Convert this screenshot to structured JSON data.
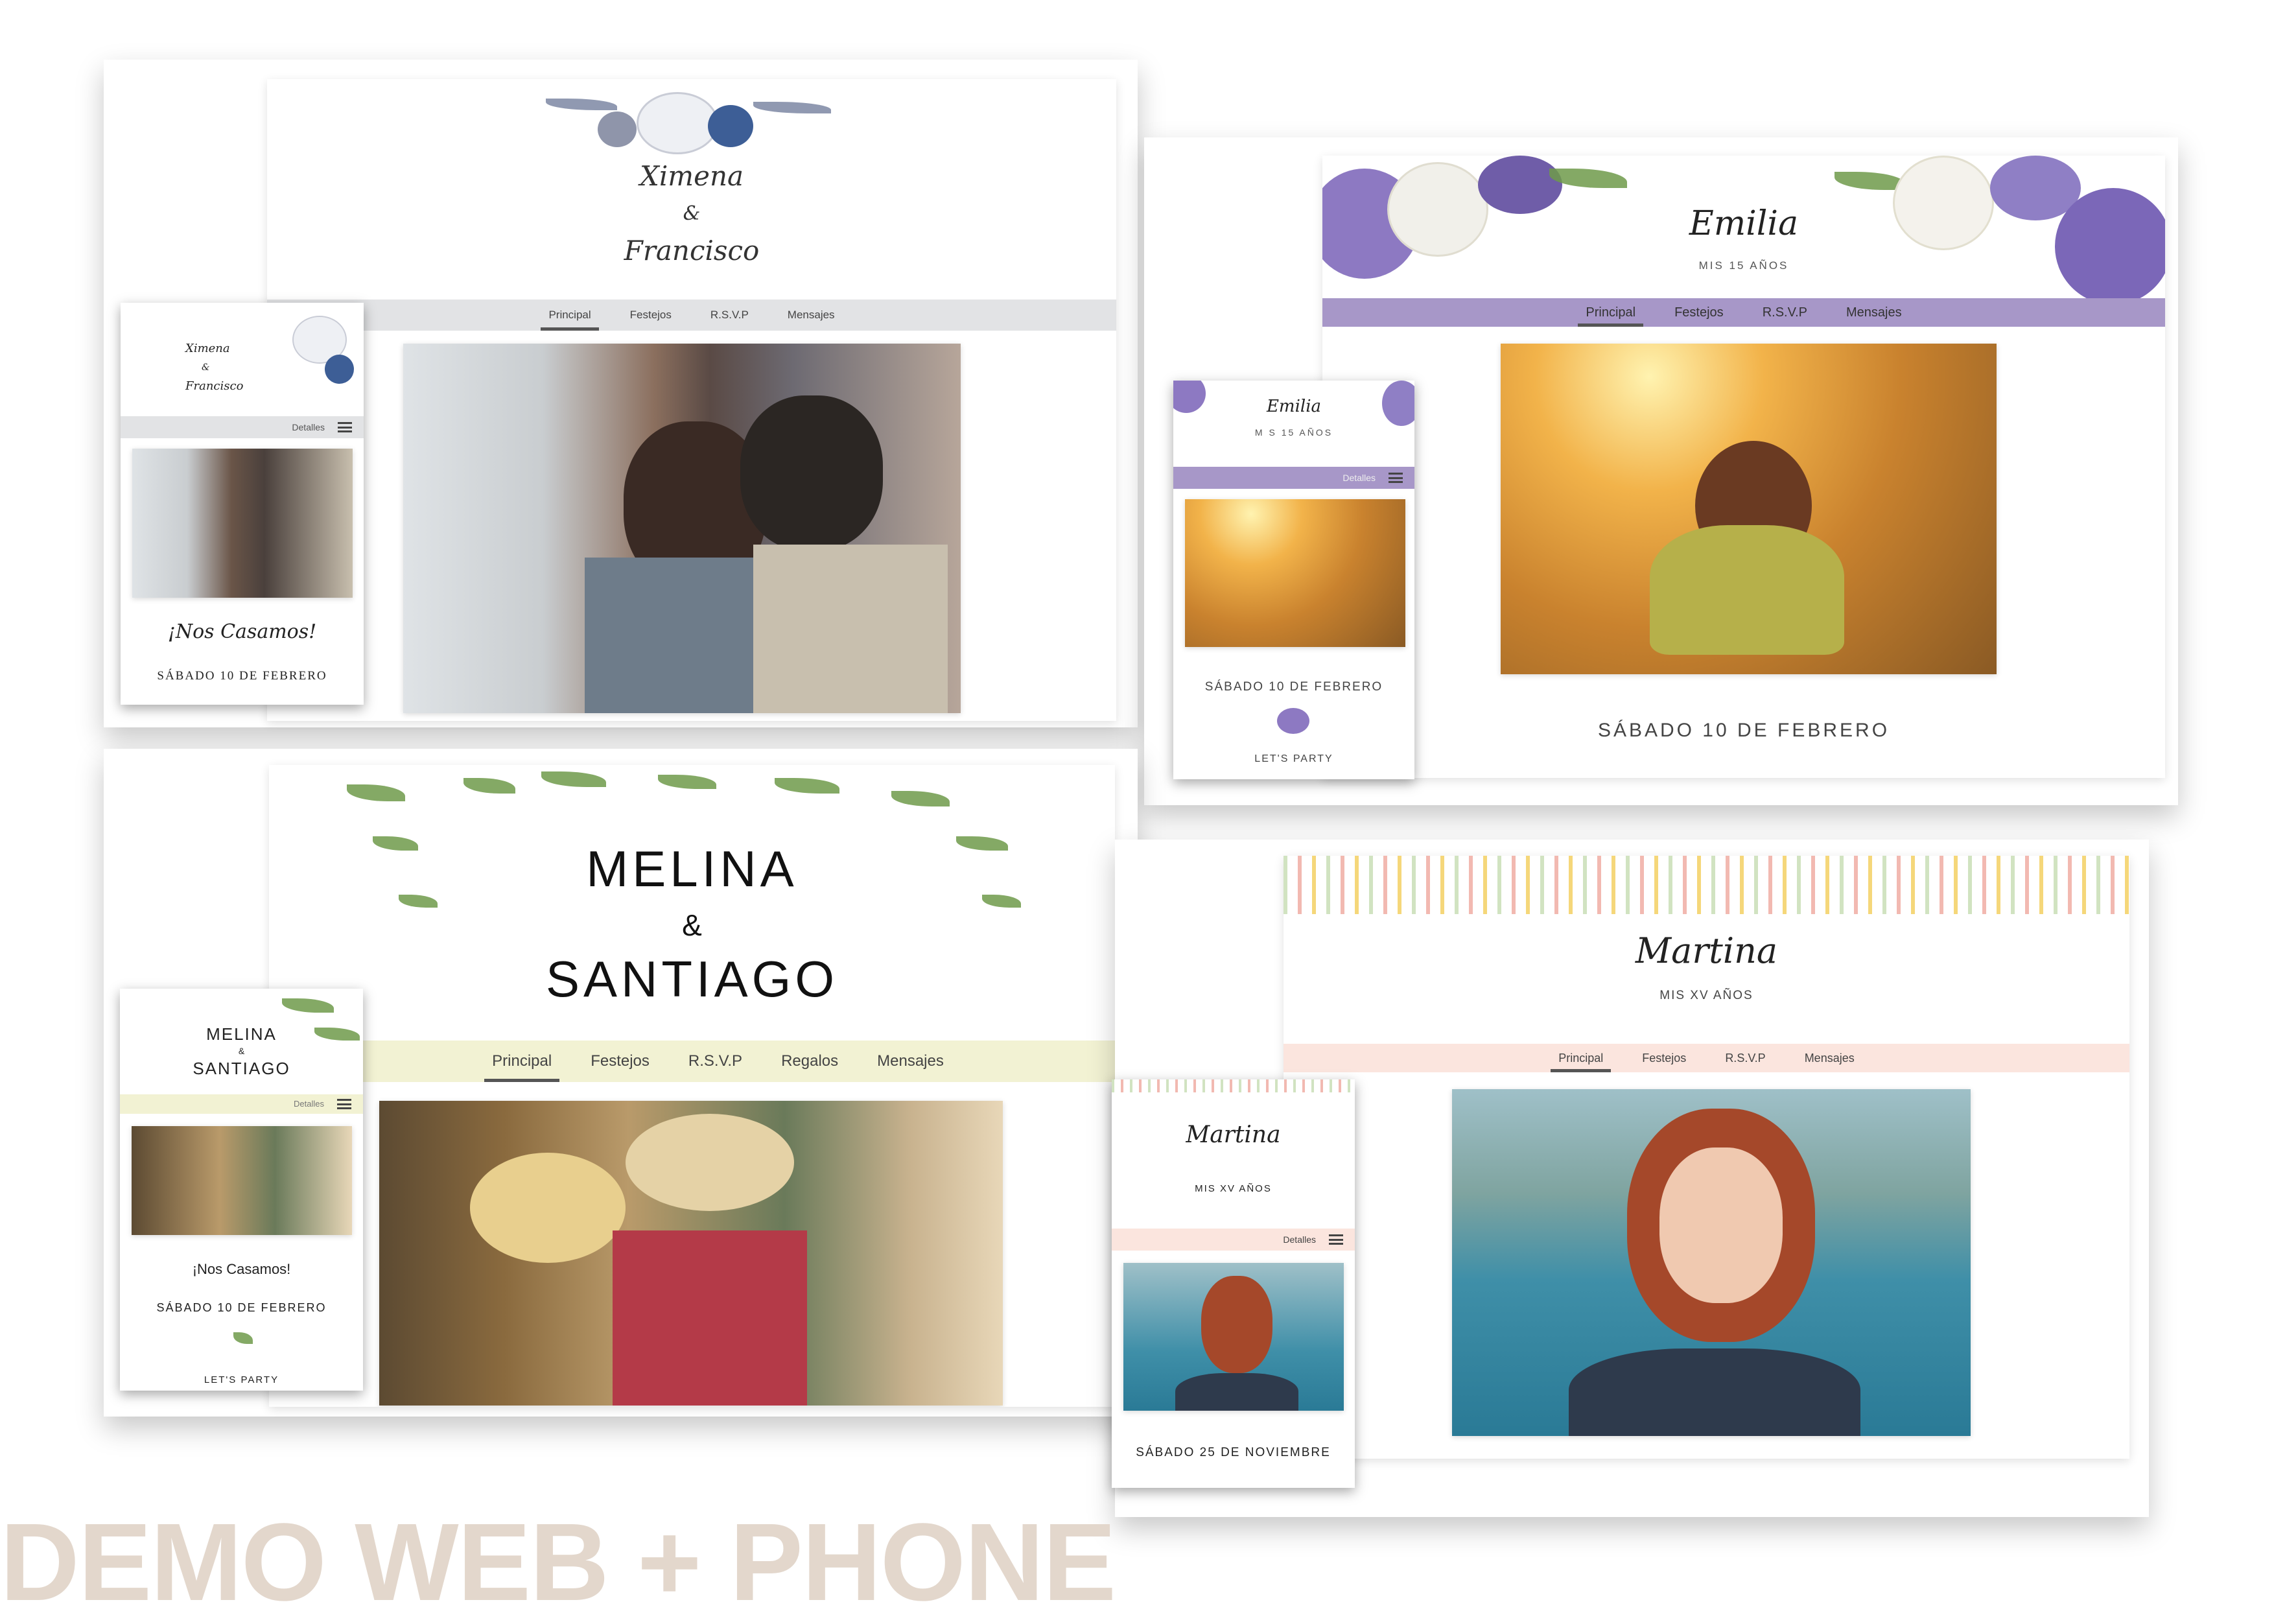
{
  "headline": "DEMO WEB + PHONE",
  "colors": {
    "headline": "#e3d7cc",
    "emilia_bar": "#a797c8",
    "melina_bar": "#f2f2d3",
    "martina_bar": "#fbe5de",
    "ximena_bar": "#e2e3e5"
  },
  "ximena": {
    "desktop": {
      "name1": "Ximena",
      "amp": "&",
      "name2": "Francisco",
      "nav": [
        "Principal",
        "Festejos",
        "R.S.V.P",
        "Mensajes"
      ]
    },
    "phone": {
      "name1": "Ximena",
      "amp": "&",
      "name2": "Francisco",
      "menu": "Detalles",
      "tagline": "¡Nos Casamos!",
      "date": "SÁBADO 10 DE FEBRERO"
    }
  },
  "emilia": {
    "desktop": {
      "name": "Emilia",
      "subtitle": "MIS 15 AÑOS",
      "nav": [
        "Principal",
        "Festejos",
        "R.S.V.P",
        "Mensajes"
      ],
      "date": "SÁBADO 10 DE FEBRERO"
    },
    "phone": {
      "name": "Emilia",
      "subtitle": "M S 15 AÑOS",
      "menu": "Detalles",
      "date": "SÁBADO 10 DE FEBRERO",
      "cta": "LET'S PARTY"
    }
  },
  "melina": {
    "desktop": {
      "name1": "MELINA",
      "amp": "&",
      "name2": "SANTIAGO",
      "nav": [
        "Principal",
        "Festejos",
        "R.S.V.P",
        "Regalos",
        "Mensajes"
      ]
    },
    "phone": {
      "name1": "MELINA",
      "amp": "&",
      "name2": "SANTIAGO",
      "menu": "Detalles",
      "tagline": "¡Nos Casamos!",
      "date": "SÁBADO 10 DE FEBRERO",
      "cta": "LET'S PARTY"
    }
  },
  "martina": {
    "desktop": {
      "name": "Martina",
      "subtitle": "MIS XV AÑOS",
      "nav": [
        "Principal",
        "Festejos",
        "R.S.V.P",
        "Mensajes"
      ]
    },
    "phone": {
      "name": "Martina",
      "subtitle": "MIS XV AÑOS",
      "menu": "Detalles",
      "date": "SÁBADO 25 DE NOVIEMBRE"
    }
  }
}
